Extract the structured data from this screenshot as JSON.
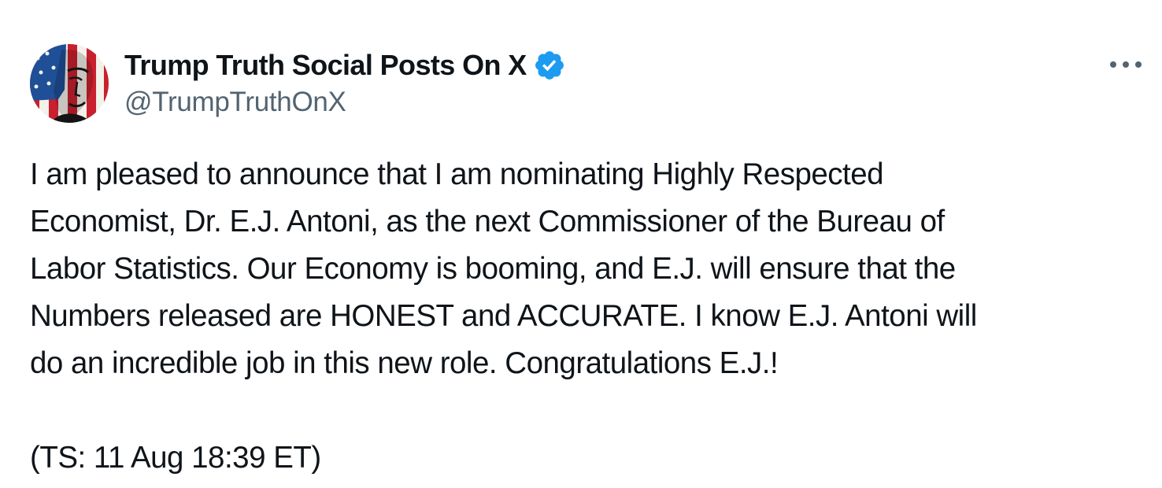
{
  "author": {
    "display_name": "Trump Truth Social Posts On X",
    "handle": "@TrumpTruthOnX",
    "verified": true,
    "verified_color": "#1d9bf0",
    "avatar_icon": "flag-portrait-avatar",
    "avatar_colors": {
      "red": "#c8202e",
      "white": "#f4f0ea",
      "blue": "#1f4f96",
      "dark": "#141414"
    }
  },
  "menu": {
    "icon": "more-options-icon",
    "glyph": "•••"
  },
  "post": {
    "text": "I am pleased to announce that I am nominating Highly Respected\nEconomist, Dr. E.J. Antoni, as the next Commissioner of the Bureau of\nLabor Statistics. Our Economy is booming, and E.J. will ensure that the\nNumbers released are HONEST and ACCURATE. I know E.J. Antoni will\ndo an incredible job in this new role. Congratulations E.J.!",
    "timestamp_note": "(TS: 11 Aug 18:39 ET)"
  },
  "colors": {
    "text": "#0f1419",
    "secondary_text": "#536471",
    "background": "#ffffff"
  }
}
